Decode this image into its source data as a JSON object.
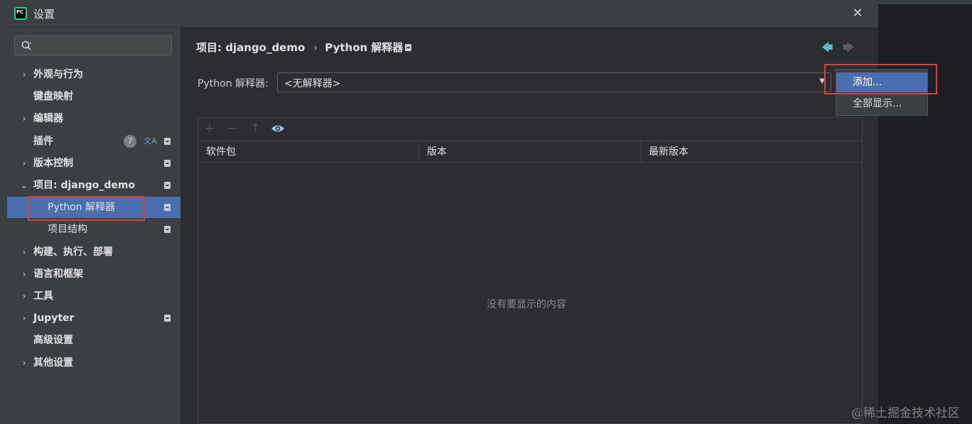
{
  "window": {
    "title": "设置",
    "close_symbol": "✕"
  },
  "sidebar": {
    "search": {
      "placeholder": ""
    },
    "items": [
      {
        "label": "外观与行为",
        "arrow": "›",
        "locked": false
      },
      {
        "label": "键盘映射",
        "arrow": "",
        "locked": false
      },
      {
        "label": "编辑器",
        "arrow": "›",
        "locked": false
      },
      {
        "label": "插件",
        "arrow": "",
        "badge": "7",
        "locked": true
      },
      {
        "label": "版本控制",
        "arrow": "›",
        "locked": true
      },
      {
        "label": "项目: django_demo",
        "arrow": "⌄",
        "locked": true
      },
      {
        "label": "Python 解释器",
        "child": true,
        "selected": true,
        "locked": true
      },
      {
        "label": "项目结构",
        "child": true,
        "locked": true
      },
      {
        "label": "构建、执行、部署",
        "arrow": "›",
        "locked": false
      },
      {
        "label": "语言和框架",
        "arrow": "›",
        "locked": false
      },
      {
        "label": "工具",
        "arrow": "›",
        "locked": false
      },
      {
        "label": "Jupyter",
        "arrow": "›",
        "locked": true
      },
      {
        "label": "高级设置",
        "arrow": "",
        "locked": false
      },
      {
        "label": "其他设置",
        "arrow": "›",
        "locked": false
      }
    ]
  },
  "content": {
    "breadcrumb": {
      "parent": "项目: django_demo",
      "separator": "›",
      "current": "Python 解释器"
    },
    "nav": {
      "back": "🡄",
      "forward": "🡆"
    },
    "interpreter": {
      "label": "Python 解释器:",
      "value": "<无解释器>"
    },
    "dropdown": {
      "items": [
        "添加...",
        "全部显示..."
      ],
      "active_index": 0
    },
    "toolbar": {
      "add": "+",
      "remove": "−",
      "upgrade": "↑",
      "show": "eye"
    },
    "table": {
      "columns": [
        "软件包",
        "版本",
        "最新版本"
      ],
      "empty_text": "没有要显示的内容"
    }
  },
  "watermark": "@稀土掘金技术社区",
  "colors": {
    "accent": "#4b6eaf",
    "highlight": "#e23b3b",
    "background": "#2b2d30",
    "panel": "#3c3f41"
  }
}
